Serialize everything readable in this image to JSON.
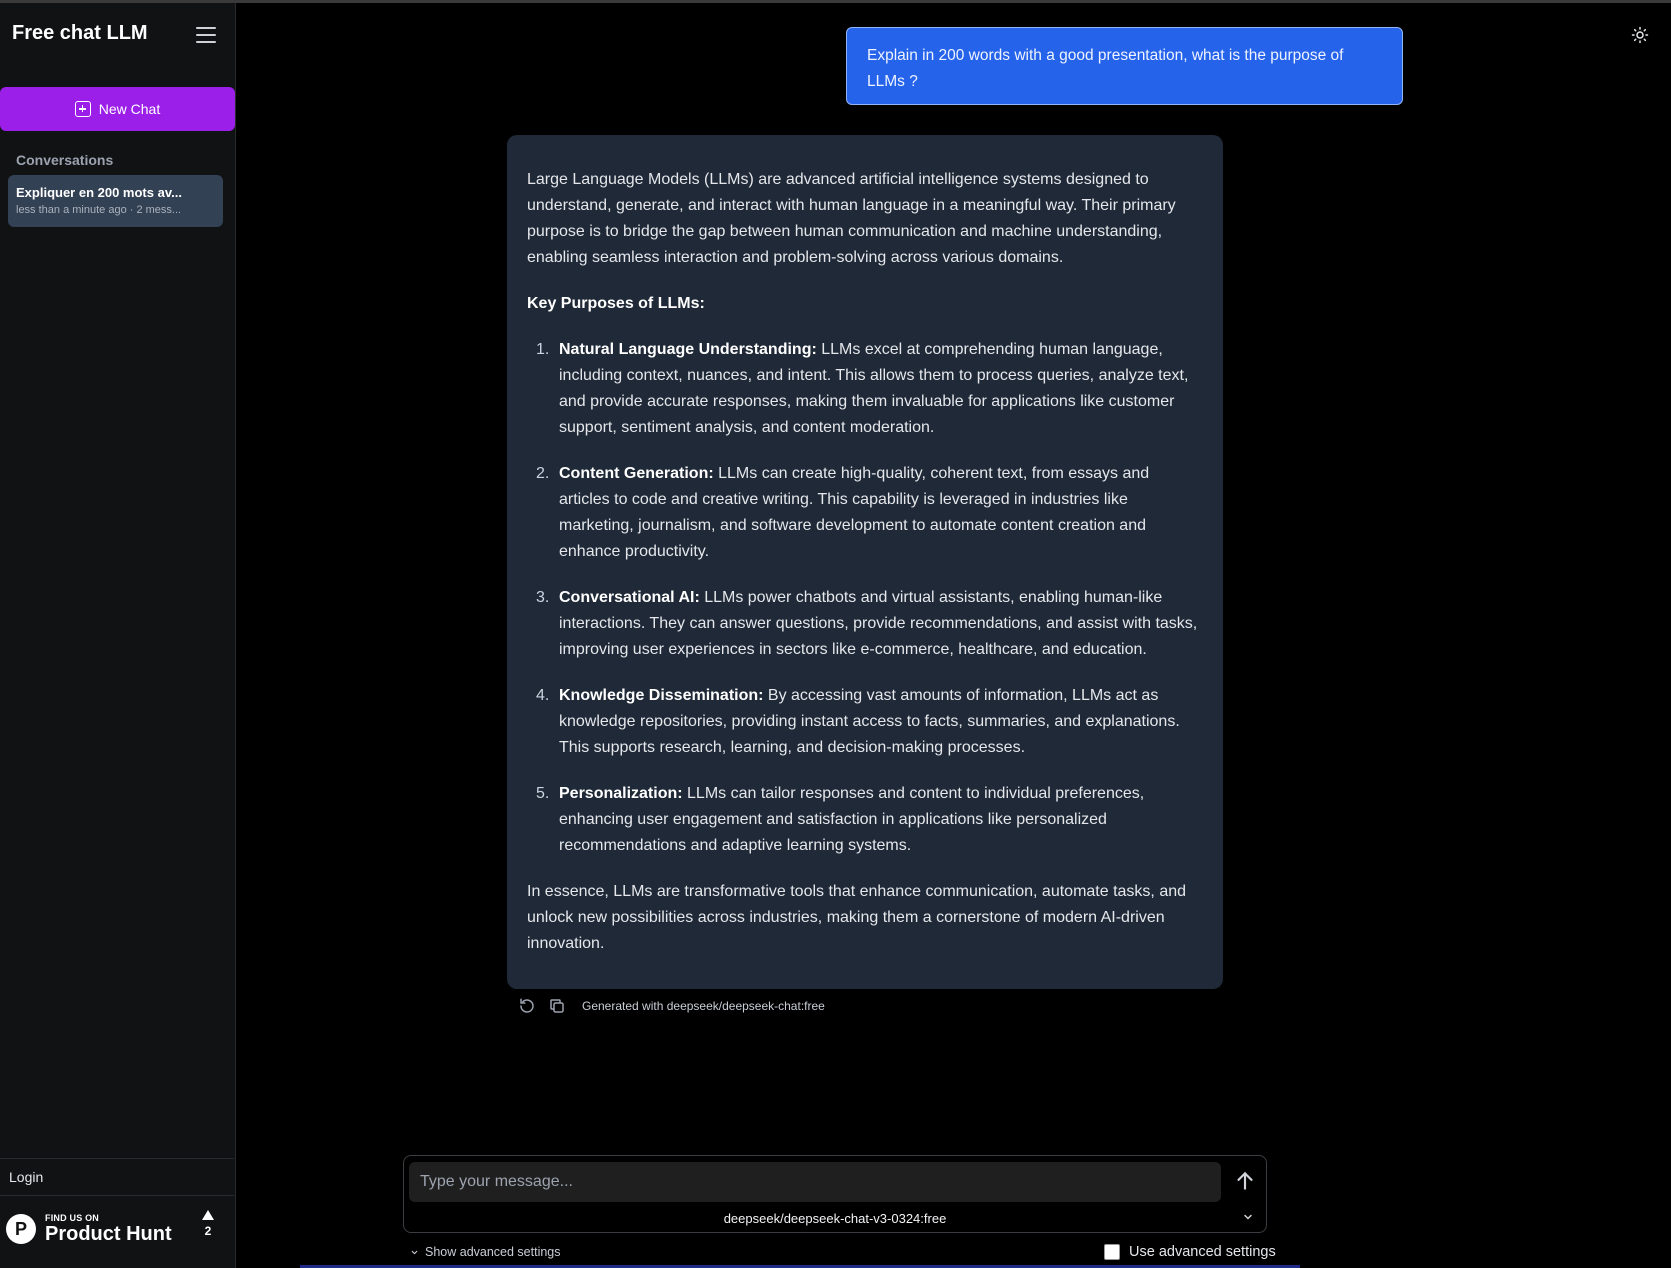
{
  "sidebar": {
    "brand": "Free chat LLM",
    "new_chat_label": "New Chat",
    "conversations_heading": "Conversations",
    "conversations": [
      {
        "title": "Expliquer en 200 mots av...",
        "meta": "less than a minute ago · 2 mess..."
      }
    ],
    "login_label": "Login",
    "product_hunt": {
      "small": "FIND US ON",
      "big": "Product Hunt",
      "count": "2"
    }
  },
  "chat": {
    "user_message": "Explain in 200 words with a good presentation, what is the purpose of LLMs ?",
    "assistant": {
      "intro": "Large Language Models (LLMs) are advanced artificial intelligence systems designed to understand, generate, and interact with human language in a meaningful way. Their primary purpose is to bridge the gap between human communication and machine understanding, enabling seamless interaction and problem-solving across various domains.",
      "heading": "Key Purposes of LLMs:",
      "items": [
        {
          "num": "1.",
          "title": "Natural Language Understanding:",
          "text": " LLMs excel at comprehending human language, including context, nuances, and intent. This allows them to process queries, analyze text, and provide accurate responses, making them invaluable for applications like customer support, sentiment analysis, and content moderation."
        },
        {
          "num": "2.",
          "title": "Content Generation:",
          "text": " LLMs can create high-quality, coherent text, from essays and articles to code and creative writing. This capability is leveraged in industries like marketing, journalism, and software development to automate content creation and enhance productivity."
        },
        {
          "num": "3.",
          "title": "Conversational AI:",
          "text": " LLMs power chatbots and virtual assistants, enabling human-like interactions. They can answer questions, provide recommendations, and assist with tasks, improving user experiences in sectors like e-commerce, healthcare, and education."
        },
        {
          "num": "4.",
          "title": "Knowledge Dissemination:",
          "text": " By accessing vast amounts of information, LLMs act as knowledge repositories, providing instant access to facts, summaries, and explanations. This supports research, learning, and decision-making processes."
        },
        {
          "num": "5.",
          "title": "Personalization:",
          "text": " LLMs can tailor responses and content to individual preferences, enhancing user engagement and satisfaction in applications like personalized recommendations and adaptive learning systems."
        }
      ],
      "conclusion": "In essence, LLMs are transformative tools that enhance communication, automate tasks, and unlock new possibilities across industries, making them a cornerstone of modern AI-driven innovation.",
      "generated_with": "Generated with deepseek/deepseek-chat:free"
    }
  },
  "composer": {
    "placeholder": "Type your message...",
    "model": "deepseek/deepseek-chat-v3-0324:free",
    "show_advanced_label": "Show advanced settings",
    "use_advanced_label": "Use advanced settings"
  },
  "colors": {
    "new_chat_bg": "#9b1fe8",
    "user_bubble_bg": "#2563eb",
    "assistant_bubble_bg": "#1f2937",
    "active_conversation_bg": "#334155"
  },
  "icons": [
    "menu-icon",
    "plus-square-icon",
    "sun-icon",
    "refresh-icon",
    "copy-icon",
    "arrow-up-icon",
    "chevron-down-icon",
    "product-hunt-icon",
    "upvote-triangle-icon"
  ]
}
